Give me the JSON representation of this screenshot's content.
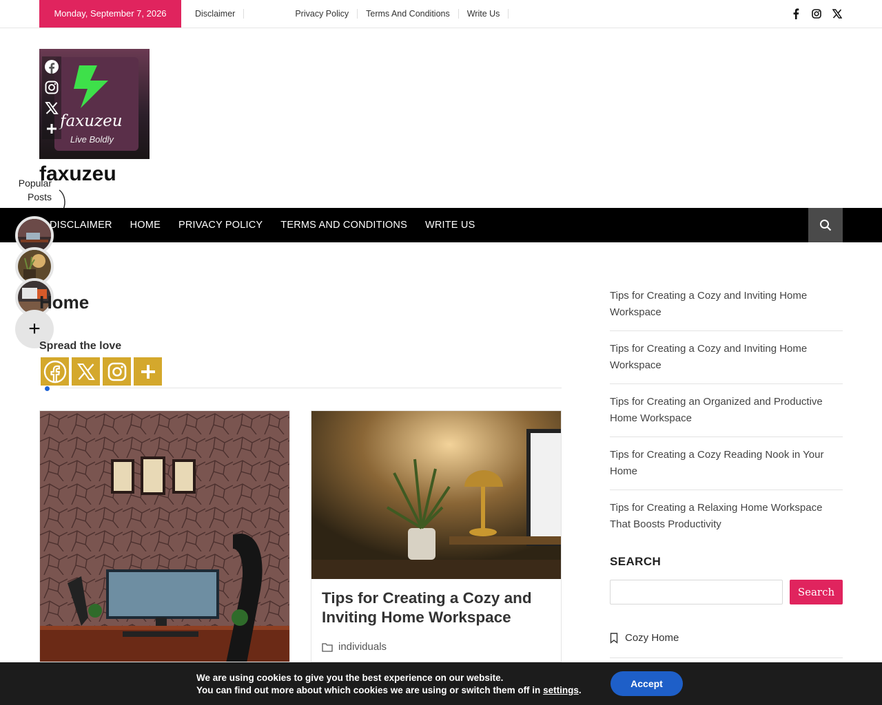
{
  "topbar": {
    "date": "Monday, September 7, 2026",
    "links": [
      "Disclaimer",
      "",
      "Privacy Policy",
      "Terms And Conditions",
      "Write Us"
    ],
    "social": [
      "facebook-icon",
      "instagram-icon",
      "x-icon"
    ]
  },
  "header": {
    "logo_wordmark": "faxuzeu",
    "logo_tagline": "Live Boldly",
    "site_title": "faxuzeu"
  },
  "floating_share": [
    "facebook-icon",
    "instagram-icon",
    "x-icon",
    "plus-icon"
  ],
  "popular_posts": {
    "label_line1": "Popular",
    "label_line2": "Posts",
    "plus": "+"
  },
  "nav": {
    "items": [
      "DISCLAIMER",
      "HOME",
      "PRIVACY POLICY",
      "TERMS AND CONDITIONS",
      "WRITE US"
    ]
  },
  "main": {
    "page_title": "Home",
    "spread_label": "Spread the love",
    "share_buttons": [
      "facebook-icon",
      "x-icon",
      "instagram-icon",
      "plus-icon"
    ],
    "cards": [
      {
        "title": "",
        "category": ""
      },
      {
        "title": "Tips for Creating a Cozy and Inviting Home Workspace",
        "category": "individuals"
      }
    ]
  },
  "sidebar": {
    "recent": [
      "Tips for Creating a Cozy and Inviting Home Workspace",
      "Tips for Creating a Cozy and Inviting Home Workspace",
      "Tips for Creating an Organized and Productive Home Workspace",
      "Tips for Creating a Cozy Reading Nook in Your Home",
      "Tips for Creating a Relaxing Home Workspace That Boosts Productivity"
    ],
    "search_heading": "SEARCH",
    "search_button": "Search",
    "category_item": "Cozy Home"
  },
  "cookie": {
    "line1": "We are using cookies to give you the best experience on our website.",
    "line2_prefix": "You can find out more about which cookies we are using or switch them off in ",
    "line2_link": "settings",
    "line2_suffix": ".",
    "accept": "Accept"
  },
  "colors": {
    "accent": "#e0245e",
    "share_gold": "#d4a82c",
    "nav_bg": "#000000",
    "cookie_bg": "#1c1c1c",
    "accept_blue": "#1e5fc8"
  }
}
